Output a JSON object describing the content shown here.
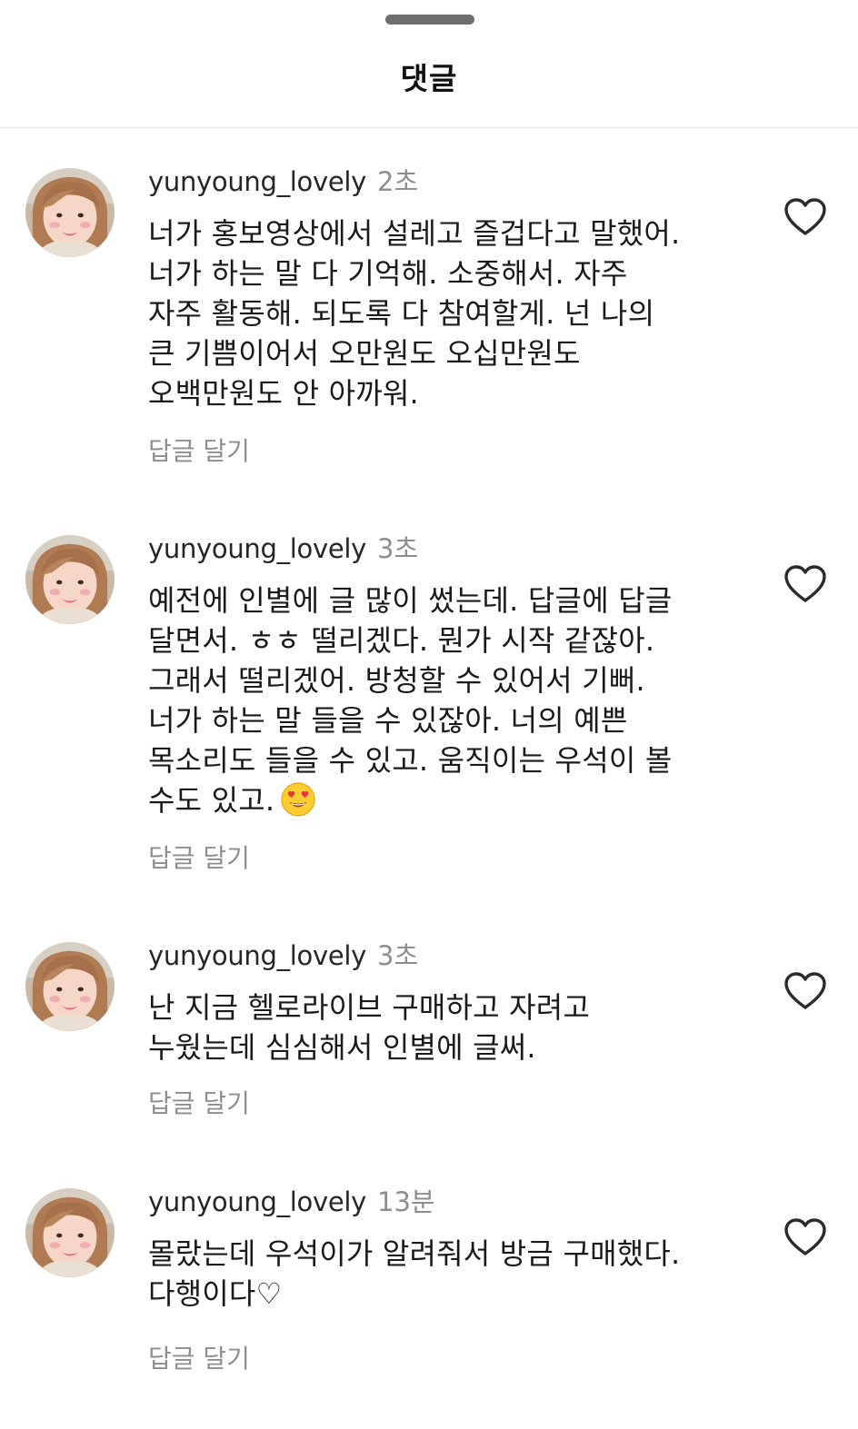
{
  "header": {
    "title": "댓글"
  },
  "comments": [
    {
      "username": "yunyoung_lovely",
      "time": "2초",
      "lines": [
        "너가 홍보영상에서 설레고 즐겁다고 말했어.",
        "너가 하는 말 다 기억해. 소중해서. 자주",
        "자주 활동해. 되도록 다 참여할게. 넌 나의",
        "큰 기쁨이어서 오만원도 오십만원도",
        "오백만원도 안 아까워."
      ],
      "reply_label": "답글 달기"
    },
    {
      "username": "yunyoung_lovely",
      "time": "3초",
      "lines": [
        "예전에 인별에 글 많이 썼는데. 답글에 답글",
        "달면서. ㅎㅎ 떨리겠다. 뭔가 시작 같잖아.",
        "그래서 떨리겠어. 방청할 수 있어서 기뻐.",
        "너가 하는 말 들을 수 있잖아. 너의 예쁜",
        "목소리도 들을 수 있고. 움직이는 우석이 볼",
        "수도 있고."
      ],
      "emoji": "heart-eyes-emoji",
      "reply_label": "답글 달기"
    },
    {
      "username": "yunyoung_lovely",
      "time": "3초",
      "lines": [
        "난 지금 헬로라이브 구매하고 자려고",
        "누웠는데 심심해서 인별에 글써."
      ],
      "reply_label": "답글 달기"
    },
    {
      "username": "yunyoung_lovely",
      "time": "13분",
      "lines": [
        "몰랐는데 우석이가 알려줘서 방금 구매했다.",
        "다행이다♡"
      ],
      "reply_label": "답글 달기"
    }
  ],
  "icons": {
    "like": "heart-outline-icon",
    "avatar": "profile-photo"
  },
  "colors": {
    "muted": "#8e8e8e",
    "text": "#1a1a1a",
    "divider": "#e6e6e6"
  }
}
